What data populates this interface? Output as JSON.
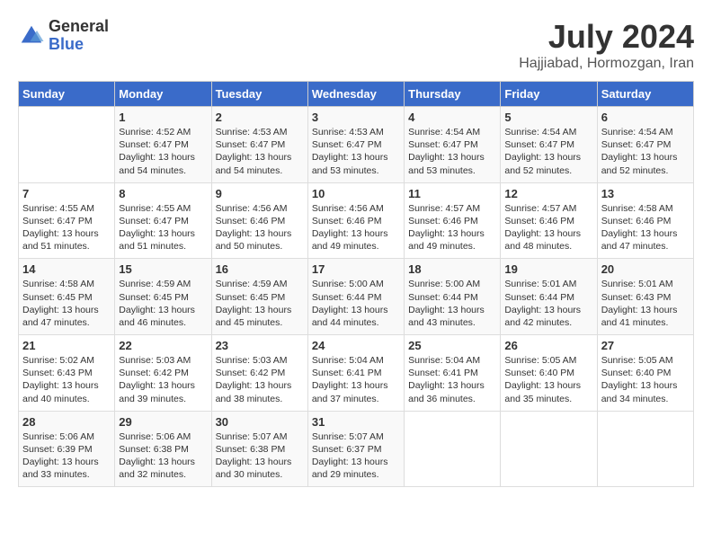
{
  "header": {
    "logo_line1": "General",
    "logo_line2": "Blue",
    "month_year": "July 2024",
    "location": "Hajjiabad, Hormozgan, Iran"
  },
  "weekdays": [
    "Sunday",
    "Monday",
    "Tuesday",
    "Wednesday",
    "Thursday",
    "Friday",
    "Saturday"
  ],
  "weeks": [
    [
      {
        "day": "",
        "sunrise": "",
        "sunset": "",
        "daylight": ""
      },
      {
        "day": "1",
        "sunrise": "Sunrise: 4:52 AM",
        "sunset": "Sunset: 6:47 PM",
        "daylight": "Daylight: 13 hours and 54 minutes."
      },
      {
        "day": "2",
        "sunrise": "Sunrise: 4:53 AM",
        "sunset": "Sunset: 6:47 PM",
        "daylight": "Daylight: 13 hours and 54 minutes."
      },
      {
        "day": "3",
        "sunrise": "Sunrise: 4:53 AM",
        "sunset": "Sunset: 6:47 PM",
        "daylight": "Daylight: 13 hours and 53 minutes."
      },
      {
        "day": "4",
        "sunrise": "Sunrise: 4:54 AM",
        "sunset": "Sunset: 6:47 PM",
        "daylight": "Daylight: 13 hours and 53 minutes."
      },
      {
        "day": "5",
        "sunrise": "Sunrise: 4:54 AM",
        "sunset": "Sunset: 6:47 PM",
        "daylight": "Daylight: 13 hours and 52 minutes."
      },
      {
        "day": "6",
        "sunrise": "Sunrise: 4:54 AM",
        "sunset": "Sunset: 6:47 PM",
        "daylight": "Daylight: 13 hours and 52 minutes."
      }
    ],
    [
      {
        "day": "7",
        "sunrise": "Sunrise: 4:55 AM",
        "sunset": "Sunset: 6:47 PM",
        "daylight": "Daylight: 13 hours and 51 minutes."
      },
      {
        "day": "8",
        "sunrise": "Sunrise: 4:55 AM",
        "sunset": "Sunset: 6:47 PM",
        "daylight": "Daylight: 13 hours and 51 minutes."
      },
      {
        "day": "9",
        "sunrise": "Sunrise: 4:56 AM",
        "sunset": "Sunset: 6:46 PM",
        "daylight": "Daylight: 13 hours and 50 minutes."
      },
      {
        "day": "10",
        "sunrise": "Sunrise: 4:56 AM",
        "sunset": "Sunset: 6:46 PM",
        "daylight": "Daylight: 13 hours and 49 minutes."
      },
      {
        "day": "11",
        "sunrise": "Sunrise: 4:57 AM",
        "sunset": "Sunset: 6:46 PM",
        "daylight": "Daylight: 13 hours and 49 minutes."
      },
      {
        "day": "12",
        "sunrise": "Sunrise: 4:57 AM",
        "sunset": "Sunset: 6:46 PM",
        "daylight": "Daylight: 13 hours and 48 minutes."
      },
      {
        "day": "13",
        "sunrise": "Sunrise: 4:58 AM",
        "sunset": "Sunset: 6:46 PM",
        "daylight": "Daylight: 13 hours and 47 minutes."
      }
    ],
    [
      {
        "day": "14",
        "sunrise": "Sunrise: 4:58 AM",
        "sunset": "Sunset: 6:45 PM",
        "daylight": "Daylight: 13 hours and 47 minutes."
      },
      {
        "day": "15",
        "sunrise": "Sunrise: 4:59 AM",
        "sunset": "Sunset: 6:45 PM",
        "daylight": "Daylight: 13 hours and 46 minutes."
      },
      {
        "day": "16",
        "sunrise": "Sunrise: 4:59 AM",
        "sunset": "Sunset: 6:45 PM",
        "daylight": "Daylight: 13 hours and 45 minutes."
      },
      {
        "day": "17",
        "sunrise": "Sunrise: 5:00 AM",
        "sunset": "Sunset: 6:44 PM",
        "daylight": "Daylight: 13 hours and 44 minutes."
      },
      {
        "day": "18",
        "sunrise": "Sunrise: 5:00 AM",
        "sunset": "Sunset: 6:44 PM",
        "daylight": "Daylight: 13 hours and 43 minutes."
      },
      {
        "day": "19",
        "sunrise": "Sunrise: 5:01 AM",
        "sunset": "Sunset: 6:44 PM",
        "daylight": "Daylight: 13 hours and 42 minutes."
      },
      {
        "day": "20",
        "sunrise": "Sunrise: 5:01 AM",
        "sunset": "Sunset: 6:43 PM",
        "daylight": "Daylight: 13 hours and 41 minutes."
      }
    ],
    [
      {
        "day": "21",
        "sunrise": "Sunrise: 5:02 AM",
        "sunset": "Sunset: 6:43 PM",
        "daylight": "Daylight: 13 hours and 40 minutes."
      },
      {
        "day": "22",
        "sunrise": "Sunrise: 5:03 AM",
        "sunset": "Sunset: 6:42 PM",
        "daylight": "Daylight: 13 hours and 39 minutes."
      },
      {
        "day": "23",
        "sunrise": "Sunrise: 5:03 AM",
        "sunset": "Sunset: 6:42 PM",
        "daylight": "Daylight: 13 hours and 38 minutes."
      },
      {
        "day": "24",
        "sunrise": "Sunrise: 5:04 AM",
        "sunset": "Sunset: 6:41 PM",
        "daylight": "Daylight: 13 hours and 37 minutes."
      },
      {
        "day": "25",
        "sunrise": "Sunrise: 5:04 AM",
        "sunset": "Sunset: 6:41 PM",
        "daylight": "Daylight: 13 hours and 36 minutes."
      },
      {
        "day": "26",
        "sunrise": "Sunrise: 5:05 AM",
        "sunset": "Sunset: 6:40 PM",
        "daylight": "Daylight: 13 hours and 35 minutes."
      },
      {
        "day": "27",
        "sunrise": "Sunrise: 5:05 AM",
        "sunset": "Sunset: 6:40 PM",
        "daylight": "Daylight: 13 hours and 34 minutes."
      }
    ],
    [
      {
        "day": "28",
        "sunrise": "Sunrise: 5:06 AM",
        "sunset": "Sunset: 6:39 PM",
        "daylight": "Daylight: 13 hours and 33 minutes."
      },
      {
        "day": "29",
        "sunrise": "Sunrise: 5:06 AM",
        "sunset": "Sunset: 6:38 PM",
        "daylight": "Daylight: 13 hours and 32 minutes."
      },
      {
        "day": "30",
        "sunrise": "Sunrise: 5:07 AM",
        "sunset": "Sunset: 6:38 PM",
        "daylight": "Daylight: 13 hours and 30 minutes."
      },
      {
        "day": "31",
        "sunrise": "Sunrise: 5:07 AM",
        "sunset": "Sunset: 6:37 PM",
        "daylight": "Daylight: 13 hours and 29 minutes."
      },
      {
        "day": "",
        "sunrise": "",
        "sunset": "",
        "daylight": ""
      },
      {
        "day": "",
        "sunrise": "",
        "sunset": "",
        "daylight": ""
      },
      {
        "day": "",
        "sunrise": "",
        "sunset": "",
        "daylight": ""
      }
    ]
  ]
}
